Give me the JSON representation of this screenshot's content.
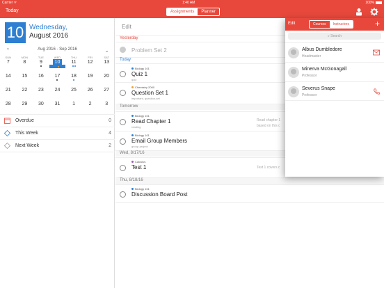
{
  "status": {
    "carrier": "Carrier ᯤ",
    "time": "1:40 AM",
    "battery": "100%"
  },
  "nav": {
    "today": "Today",
    "tabs": [
      "Assignments",
      "Planner"
    ]
  },
  "date": {
    "day": "10",
    "title": "Wednesday,",
    "sub": "August 2016"
  },
  "calendar": {
    "range": "Aug 2016 - Sep 2016",
    "dow": [
      "SUN",
      "MON",
      "TUE",
      "WED",
      "THU",
      "FRI",
      "SAT"
    ],
    "weeks": [
      [
        "7",
        "8",
        "9",
        "10",
        "11",
        "12",
        "13"
      ],
      [
        "14",
        "15",
        "16",
        "17",
        "18",
        "19",
        "20"
      ],
      [
        "21",
        "22",
        "23",
        "24",
        "25",
        "26",
        "27"
      ],
      [
        "28",
        "29",
        "30",
        "31",
        "1",
        "2",
        "3"
      ]
    ]
  },
  "summary": [
    {
      "label": "Overdue",
      "count": "0"
    },
    {
      "label": "This Week",
      "count": "4"
    },
    {
      "label": "Next Week",
      "count": "2"
    }
  ],
  "main": {
    "edit": "Edit",
    "yesterday": "Yesterday",
    "today": "Today",
    "tomorrow": "Tomorrow",
    "wed": "Wed, 8/17/16",
    "thu": "Thu, 8/18/16",
    "tasks": [
      {
        "title": "Problem Set 2"
      },
      {
        "course": "Biology 101",
        "title": "Quiz 1",
        "tags": "quiz"
      },
      {
        "course": "Chemistry 2000",
        "title": "Question Set 1",
        "tags": "important, question-set"
      },
      {
        "course": "Biology 101",
        "title": "Read Chapter 1",
        "tags": "reading",
        "note1": "Read chapter 1",
        "note2": "based on this c"
      },
      {
        "course": "Biology 101",
        "title": "Email Group Members",
        "tags": "group-project"
      },
      {
        "course": "Calculus",
        "title": "Test 1",
        "note1": "Test 1 covers c"
      },
      {
        "course": "Biology 101",
        "title": "Discussion Board Post"
      }
    ]
  },
  "popover": {
    "edit": "Edit",
    "tabs": [
      "Courses",
      "Instructors"
    ],
    "plus": "+",
    "search": "Search",
    "people": [
      {
        "name": "Albus Dumbledore",
        "role": "Headmaster"
      },
      {
        "name": "Minerva McGonagall",
        "role": "Professor"
      },
      {
        "name": "Severus Snape",
        "role": "Professor"
      }
    ]
  },
  "colors": {
    "accent": "#e8483c",
    "blue": "#2e7fd1",
    "orange": "#f0a030",
    "purple": "#9b59b6"
  }
}
